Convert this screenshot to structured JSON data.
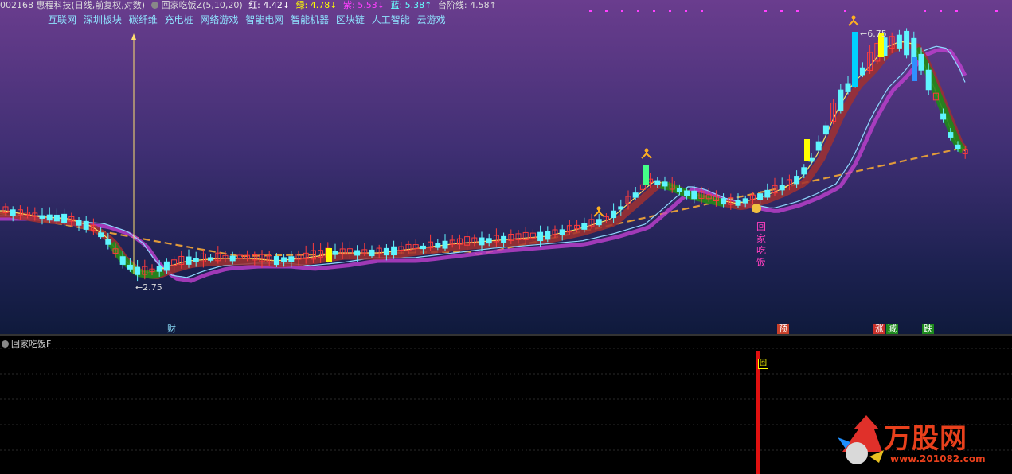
{
  "header": {
    "stock": "002168 惠程科技(日线,前复权,对数)",
    "indicator": "回家吃饭Z(5,10,20)",
    "red_label": "红: 4.42↓",
    "green_label": "绿: 4.78↓",
    "purple_label": "紫: 5.53↓",
    "blue_label": "蓝: 5.38↑",
    "step_label": "台阶线: 4.58↑"
  },
  "concepts": [
    "互联网",
    "深圳板块",
    "碳纤维",
    "充电桩",
    "网络游戏",
    "智能电网",
    "智能机器",
    "区块链",
    "人工智能",
    "云游戏"
  ],
  "annotations": {
    "low_price": "←2.75",
    "high_price": "←6.75",
    "vertical_text": "回家吃饭",
    "sub_marker": "回"
  },
  "events": {
    "cai": "财",
    "yu": "预",
    "zhang": "涨",
    "jian": "减",
    "die": "跌"
  },
  "sub_panel": {
    "title": "回家吃饭F"
  },
  "logo": {
    "brand": "万股网",
    "url": "www.201082.com"
  },
  "colors": {
    "up": "#ff3c3c",
    "down": "#5ff5ff",
    "step": "#e09a3a",
    "fill_up": "#a03030",
    "fill_down": "#1c8a1c"
  }
}
